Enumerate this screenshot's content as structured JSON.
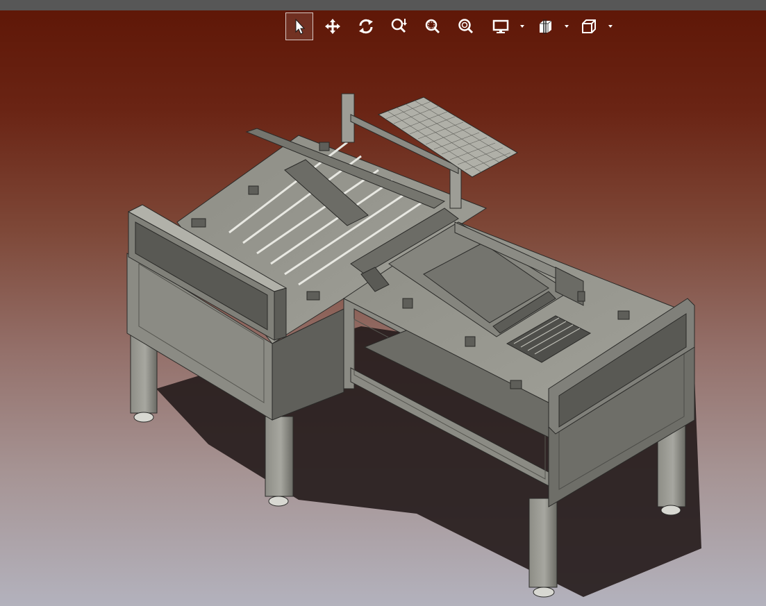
{
  "toolbar": {
    "tools": [
      {
        "name": "select-icon",
        "active": true
      },
      {
        "name": "pan-icon",
        "active": false
      },
      {
        "name": "rotate-icon",
        "active": false
      },
      {
        "name": "zoom-icon",
        "active": false
      },
      {
        "name": "zoom-window-icon",
        "active": false
      },
      {
        "name": "zoom-fit-icon",
        "active": false
      },
      {
        "name": "display-mode-icon",
        "active": false,
        "dropdown": true
      },
      {
        "name": "section-view-icon",
        "active": false,
        "dropdown": true
      },
      {
        "name": "view-cube-icon",
        "active": false,
        "dropdown": true
      }
    ]
  },
  "colors": {
    "background_top": "#5e1606",
    "background_bottom": "#b3b2bd",
    "model_face_light": "#93938a",
    "model_face_mid": "#75756e",
    "model_face_dark": "#4f4f4b",
    "shadow": "#251c1c",
    "active_tool_border": "#d8c8c4"
  }
}
